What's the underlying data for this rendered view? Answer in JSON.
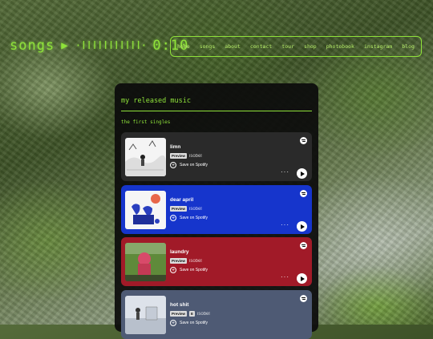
{
  "header": {
    "title": "songs",
    "play_glyph": "▶",
    "bars_glyph": "·ǀǀǀǀǀǀǀǀǀǀǀ·",
    "time": "0:10"
  },
  "nav": {
    "items": [
      "home",
      "songs",
      "about",
      "contact",
      "tour",
      "shop",
      "photobook",
      "instagram",
      "blog"
    ]
  },
  "panel": {
    "title": "my released music",
    "section_title": "the first singles"
  },
  "cards": [
    {
      "title": "limn",
      "badge": "Preview",
      "artist": "isobel",
      "save_label": "Save on Spotify",
      "bg": "#2a2a2a"
    },
    {
      "title": "dear april",
      "badge": "Preview",
      "artist": "isobel",
      "save_label": "Save on Spotify",
      "bg": "#1635cc"
    },
    {
      "title": "laundry",
      "badge": "Preview",
      "artist": "isobel",
      "save_label": "Save on Spotify",
      "bg": "#a11a28"
    },
    {
      "title": "hot shit",
      "badge": "Preview",
      "artist": "isobel",
      "save_label": "Save on Spotify",
      "bg": "#4e5a74"
    }
  ],
  "colors": {
    "accent": "#8fe23a",
    "panel": "#0c0c0c"
  },
  "icons": {
    "spotify": "spotify-icon",
    "add": "plus-circle-icon",
    "more": "more-dots-icon",
    "play": "play-icon"
  }
}
